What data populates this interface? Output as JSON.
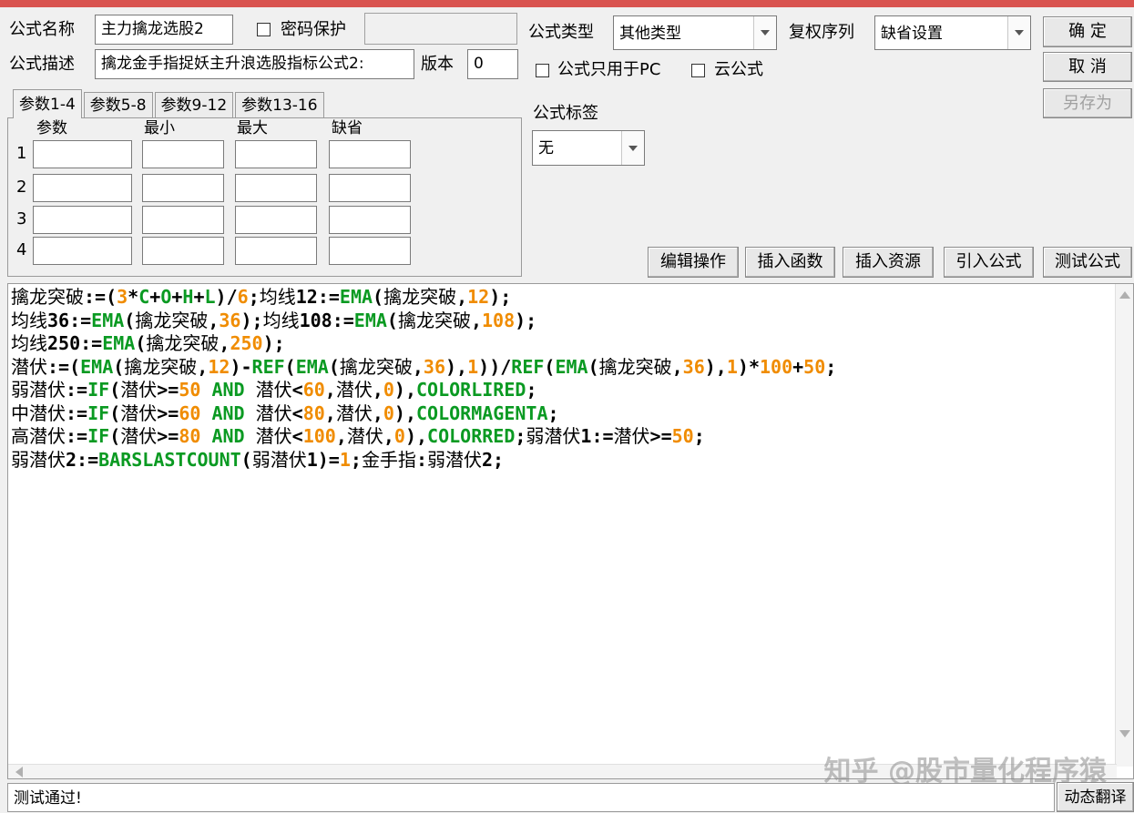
{
  "header": {
    "name_label": "公式名称",
    "name_value": "主力擒龙选股2",
    "password_label": "密码保护",
    "desc_label": "公式描述",
    "desc_value": "擒龙金手指捉妖主升浪选股指标公式2:",
    "version_label": "版本",
    "version_value": "0",
    "type_label": "公式类型",
    "type_value": "其他类型",
    "rights_label": "复权序列",
    "rights_value": "缺省设置",
    "pc_only_label": "公式只用于PC",
    "cloud_label": "云公式",
    "tag_label": "公式标签",
    "tag_value": "无"
  },
  "buttons": {
    "ok": "确 定",
    "cancel": "取 消",
    "save_as": "另存为",
    "edit_ops": "编辑操作",
    "insert_func": "插入函数",
    "insert_res": "插入资源",
    "import_formula": "引入公式",
    "test_formula": "测试公式",
    "dynamic_translate": "动态翻译"
  },
  "params": {
    "tabs": [
      "参数1-4",
      "参数5-8",
      "参数9-12",
      "参数13-16"
    ],
    "columns": [
      "参数",
      "最小",
      "最大",
      "缺省"
    ],
    "rows": [
      "1",
      "2",
      "3",
      "4"
    ]
  },
  "status": {
    "text": "测试通过!"
  },
  "watermark": "知乎 @股市量化程序猿",
  "code_lines": [
    [
      [
        "t",
        "擒龙突破"
      ],
      [
        "o",
        ":=("
      ],
      [
        "n",
        "3"
      ],
      [
        "o",
        "*"
      ],
      [
        "k",
        "C"
      ],
      [
        "o",
        "+"
      ],
      [
        "k",
        "O"
      ],
      [
        "o",
        "+"
      ],
      [
        "k",
        "H"
      ],
      [
        "o",
        "+"
      ],
      [
        "k",
        "L"
      ],
      [
        "o",
        ")/"
      ],
      [
        "n",
        "6"
      ],
      [
        "o",
        ";"
      ],
      [
        "t",
        "均线"
      ],
      [
        "o",
        "12:="
      ],
      [
        "k",
        "EMA"
      ],
      [
        "o",
        "("
      ],
      [
        "t",
        "擒龙突破"
      ],
      [
        "o",
        ","
      ],
      [
        "n",
        "12"
      ],
      [
        "o",
        ");"
      ]
    ],
    [
      [
        "t",
        "均线"
      ],
      [
        "o",
        "36:="
      ],
      [
        "k",
        "EMA"
      ],
      [
        "o",
        "("
      ],
      [
        "t",
        "擒龙突破"
      ],
      [
        "o",
        ","
      ],
      [
        "n",
        "36"
      ],
      [
        "o",
        ");"
      ],
      [
        "t",
        "均线"
      ],
      [
        "o",
        "108:="
      ],
      [
        "k",
        "EMA"
      ],
      [
        "o",
        "("
      ],
      [
        "t",
        "擒龙突破"
      ],
      [
        "o",
        ","
      ],
      [
        "n",
        "108"
      ],
      [
        "o",
        ");"
      ]
    ],
    [
      [
        "t",
        "均线"
      ],
      [
        "o",
        "250:="
      ],
      [
        "k",
        "EMA"
      ],
      [
        "o",
        "("
      ],
      [
        "t",
        "擒龙突破"
      ],
      [
        "o",
        ","
      ],
      [
        "n",
        "250"
      ],
      [
        "o",
        ");"
      ]
    ],
    [
      [
        "t",
        "潜伏"
      ],
      [
        "o",
        ":=("
      ],
      [
        "k",
        "EMA"
      ],
      [
        "o",
        "("
      ],
      [
        "t",
        "擒龙突破"
      ],
      [
        "o",
        ","
      ],
      [
        "n",
        "12"
      ],
      [
        "o",
        ")-"
      ],
      [
        "k",
        "REF"
      ],
      [
        "o",
        "("
      ],
      [
        "k",
        "EMA"
      ],
      [
        "o",
        "("
      ],
      [
        "t",
        "擒龙突破"
      ],
      [
        "o",
        ","
      ],
      [
        "n",
        "36"
      ],
      [
        "o",
        "),"
      ],
      [
        "n",
        "1"
      ],
      [
        "o",
        "))/"
      ],
      [
        "k",
        "REF"
      ],
      [
        "o",
        "("
      ],
      [
        "k",
        "EMA"
      ],
      [
        "o",
        "("
      ],
      [
        "t",
        "擒龙突破"
      ],
      [
        "o",
        ","
      ],
      [
        "n",
        "36"
      ],
      [
        "o",
        "),"
      ],
      [
        "n",
        "1"
      ],
      [
        "o",
        ")*"
      ],
      [
        "n",
        "100"
      ],
      [
        "o",
        "+"
      ],
      [
        "n",
        "50"
      ],
      [
        "o",
        ";"
      ]
    ],
    [
      [
        "t",
        "弱潜伏"
      ],
      [
        "o",
        ":="
      ],
      [
        "k",
        "IF"
      ],
      [
        "o",
        "("
      ],
      [
        "t",
        "潜伏"
      ],
      [
        "o",
        ">="
      ],
      [
        "n",
        "50"
      ],
      [
        "o",
        " "
      ],
      [
        "k",
        "AND"
      ],
      [
        "o",
        " "
      ],
      [
        "t",
        "潜伏"
      ],
      [
        "o",
        "<"
      ],
      [
        "n",
        "60"
      ],
      [
        "o",
        ","
      ],
      [
        "t",
        "潜伏"
      ],
      [
        "o",
        ","
      ],
      [
        "n",
        "0"
      ],
      [
        "o",
        "),"
      ],
      [
        "k",
        "COLORLIRED"
      ],
      [
        "o",
        ";"
      ]
    ],
    [
      [
        "t",
        "中潜伏"
      ],
      [
        "o",
        ":="
      ],
      [
        "k",
        "IF"
      ],
      [
        "o",
        "("
      ],
      [
        "t",
        "潜伏"
      ],
      [
        "o",
        ">="
      ],
      [
        "n",
        "60"
      ],
      [
        "o",
        " "
      ],
      [
        "k",
        "AND"
      ],
      [
        "o",
        " "
      ],
      [
        "t",
        "潜伏"
      ],
      [
        "o",
        "<"
      ],
      [
        "n",
        "80"
      ],
      [
        "o",
        ","
      ],
      [
        "t",
        "潜伏"
      ],
      [
        "o",
        ","
      ],
      [
        "n",
        "0"
      ],
      [
        "o",
        "),"
      ],
      [
        "k",
        "COLORMAGENTA"
      ],
      [
        "o",
        ";"
      ]
    ],
    [
      [
        "t",
        "高潜伏"
      ],
      [
        "o",
        ":="
      ],
      [
        "k",
        "IF"
      ],
      [
        "o",
        "("
      ],
      [
        "t",
        "潜伏"
      ],
      [
        "o",
        ">="
      ],
      [
        "n",
        "80"
      ],
      [
        "o",
        " "
      ],
      [
        "k",
        "AND"
      ],
      [
        "o",
        " "
      ],
      [
        "t",
        "潜伏"
      ],
      [
        "o",
        "<"
      ],
      [
        "n",
        "100"
      ],
      [
        "o",
        ","
      ],
      [
        "t",
        "潜伏"
      ],
      [
        "o",
        ","
      ],
      [
        "n",
        "0"
      ],
      [
        "o",
        "),"
      ],
      [
        "k",
        "COLORRED"
      ],
      [
        "o",
        ";"
      ],
      [
        "t",
        "弱潜伏"
      ],
      [
        "o",
        "1:="
      ],
      [
        "t",
        "潜伏"
      ],
      [
        "o",
        ">="
      ],
      [
        "n",
        "50"
      ],
      [
        "o",
        ";"
      ]
    ],
    [
      [
        "t",
        "弱潜伏"
      ],
      [
        "o",
        "2:="
      ],
      [
        "k",
        "BARSLASTCOUNT"
      ],
      [
        "o",
        "("
      ],
      [
        "t",
        "弱潜伏"
      ],
      [
        "o",
        "1)="
      ],
      [
        "n",
        "1"
      ],
      [
        "o",
        ";"
      ],
      [
        "t",
        "金手指"
      ],
      [
        "o",
        ":"
      ],
      [
        "t",
        "弱潜伏"
      ],
      [
        "o",
        "2;"
      ]
    ]
  ]
}
